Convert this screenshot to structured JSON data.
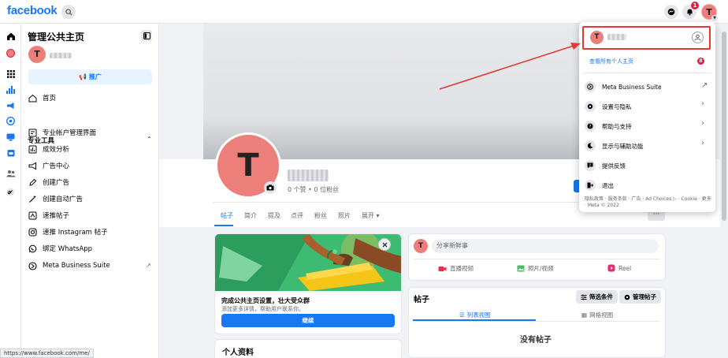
{
  "topbar": {
    "logo": "facebook",
    "notification_count": "1",
    "avatar_letter": "T"
  },
  "panel": {
    "title": "管理公共主页",
    "avatar_letter": "T",
    "promote_label": "推广",
    "home_label": "首页",
    "section_title": "专业工具",
    "tools": [
      {
        "label": "专业帐户管理界面"
      },
      {
        "label": "成效分析"
      },
      {
        "label": "广告中心"
      },
      {
        "label": "创建广告"
      },
      {
        "label": "创建自动广告"
      },
      {
        "label": "速推帖子"
      },
      {
        "label": "速推 Instagram 帖子"
      },
      {
        "label": "绑定 WhatsApp"
      },
      {
        "label": "Meta Business Suite"
      }
    ]
  },
  "status_url": "https://www.facebook.com/me/",
  "page": {
    "avatar_letter": "T",
    "stats": "0 个赞 • 0 位粉丝",
    "tabs": [
      "帖子",
      "简介",
      "提及",
      "点评",
      "粉丝",
      "照片",
      "展开 ▾"
    ],
    "more_label": "···"
  },
  "setup_card": {
    "title": "完成公共主页设置，壮大受众群",
    "desc": "添加更多详情，帮助用户联系你。",
    "button": "继续"
  },
  "profile_card": {
    "heading": "个人资料"
  },
  "compose": {
    "avatar_letter": "T",
    "placeholder": "分享新鲜事",
    "actions": [
      "直播视频",
      "照片/视频",
      "Reel"
    ]
  },
  "posts": {
    "title": "帖子",
    "filter_label": "筛选条件",
    "manage_label": "管理帖子",
    "list_view": "列表视图",
    "grid_view": "网格视图",
    "empty": "没有帖子"
  },
  "menu": {
    "avatar_letter": "T",
    "see_all": "查看所有个人主页",
    "see_all_badge": "8",
    "items": [
      {
        "label": "Meta Business Suite"
      },
      {
        "label": "设置与隐私"
      },
      {
        "label": "帮助与支持"
      },
      {
        "label": "显示与辅助功能"
      },
      {
        "label": "提供反馈"
      },
      {
        "label": "退出"
      }
    ],
    "footer": "隐私政策 · 服务条款 · 广告 · Ad Choices ▷ · Cookie · 更多 · Meta © 2022"
  },
  "colors": {
    "brand": "#1877f2",
    "avatar": "#ed7f7a",
    "highlight": "#e53935"
  }
}
